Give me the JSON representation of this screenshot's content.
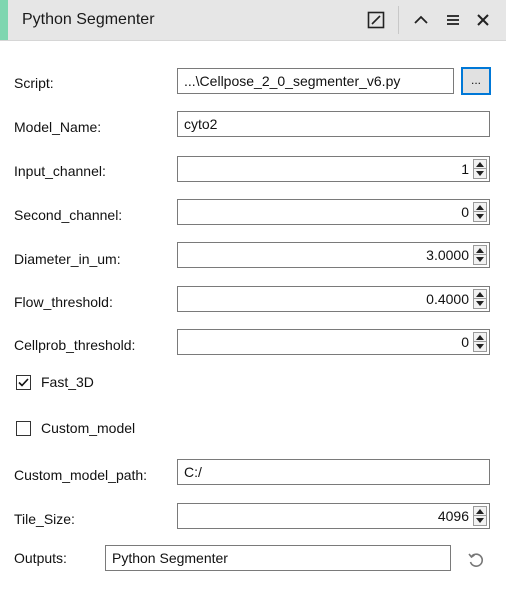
{
  "title": "Python Segmenter",
  "fields": {
    "script": {
      "label": "Script:",
      "value": "...\\Cellpose_2_0_segmenter_v6.py",
      "browse_label": "..."
    },
    "model_name": {
      "label": "Model_Name:",
      "value": "cyto2"
    },
    "input_channel": {
      "label": "Input_channel:",
      "value": "1"
    },
    "second_channel": {
      "label": "Second_channel:",
      "value": "0"
    },
    "diameter": {
      "label": "Diameter_in_um:",
      "value": "3.0000"
    },
    "flow_threshold": {
      "label": "Flow_threshold:",
      "value": "0.4000"
    },
    "cellprob_threshold": {
      "label": "Cellprob_threshold:",
      "value": "0"
    },
    "fast_3d": {
      "label": "Fast_3D",
      "checked": true
    },
    "custom_model": {
      "label": "Custom_model",
      "checked": false
    },
    "custom_model_path": {
      "label": "Custom_model_path:",
      "value": "C:/"
    },
    "tile_size": {
      "label": "Tile_Size:",
      "value": "4096"
    },
    "outputs": {
      "label": "Outputs:",
      "value": "Python Segmenter"
    }
  },
  "colors": {
    "accent": "#7fd6b0",
    "focus": "#0078d7"
  },
  "icons": [
    "edit-icon",
    "chevron-up-icon",
    "menu-icon",
    "close-icon",
    "reset-icon"
  ]
}
